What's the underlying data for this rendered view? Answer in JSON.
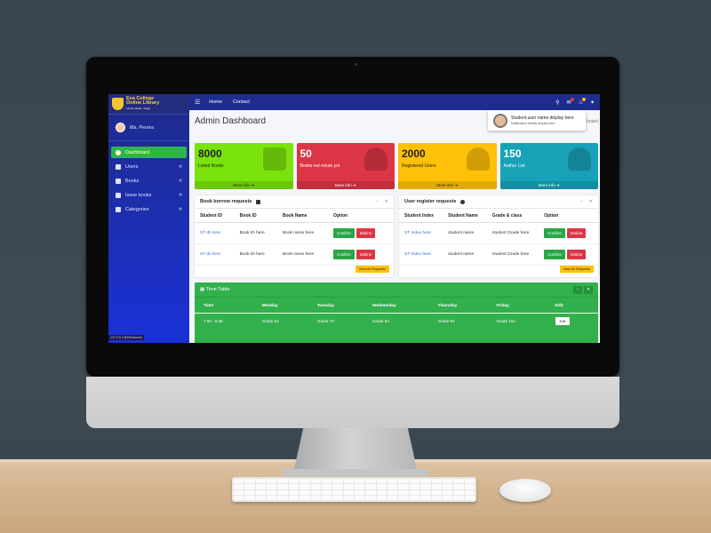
{
  "sidebar": {
    "brand_line1": "Eva College",
    "brand_line2": "Online Library",
    "brand_line3": "Lar Ho Road - Kaga",
    "user_name": "Ms. Perera",
    "items": [
      {
        "label": "Dashboard",
        "active": true
      },
      {
        "label": "Users",
        "chevron": "«"
      },
      {
        "label": "Books",
        "chevron": "«"
      },
      {
        "label": "Issue books",
        "chevron": "«"
      },
      {
        "label": "Categories",
        "chevron": "«"
      }
    ],
    "status_url": "127.0.0.1:8000/admin#"
  },
  "topbar": {
    "menu_glyph": "☰",
    "links": [
      "Home",
      "Contact"
    ],
    "icons": [
      "search-icon",
      "chat-icon",
      "bell-icon",
      "expand-icon"
    ]
  },
  "page": {
    "title": "Admin Dashboard",
    "breadcrumb_fragment": "board"
  },
  "notification": {
    "title": "Student,user name display here",
    "subtitle": "Notification details display here"
  },
  "stats": [
    {
      "value": "8000",
      "label": "Listed Books",
      "more": "More info ➜",
      "color": "#7ae30b"
    },
    {
      "value": "50",
      "label": "Books not reture yet",
      "more": "More info ➜",
      "color": "#dc3545"
    },
    {
      "value": "2000",
      "label": "Registered Users",
      "more": "More info ➜",
      "color": "#ffc107"
    },
    {
      "value": "150",
      "label": "Author List",
      "more": "More info ➜",
      "color": "#17a2b8"
    }
  ],
  "borrow": {
    "title": "Book borrow requests",
    "headers": [
      "Student ID",
      "Book ID",
      "Book Name",
      "Option"
    ],
    "rows": [
      [
        "ST ID here",
        "Book ID here",
        "Book name here"
      ],
      [
        "ST ID here",
        "Book ID here",
        "Book name here"
      ]
    ],
    "confirm": "Confirm",
    "decline": "Disline",
    "view_all": "View All Requests"
  },
  "register": {
    "title": "User register requests",
    "headers": [
      "Student Index",
      "Student Name",
      "Grade & class",
      "Option"
    ],
    "rows": [
      [
        "ST Index here",
        "student name",
        "student Grade here"
      ],
      [
        "ST Index here",
        "student name",
        "student Grade here"
      ]
    ],
    "confirm": "Confirm",
    "decline": "Disline",
    "view_all": "View All Requests"
  },
  "timetable": {
    "title": "Time Table",
    "headers": [
      "Time",
      "Monday",
      "Tuesday",
      "Wednesday",
      "Thursday",
      "Friday",
      "Edit"
    ],
    "row": [
      "7.50 - 8.30",
      "Grade 6A",
      "Grade 7A",
      "Grade 8A",
      "Grade 9A",
      "Grade 10A"
    ],
    "edit": "Edit"
  }
}
